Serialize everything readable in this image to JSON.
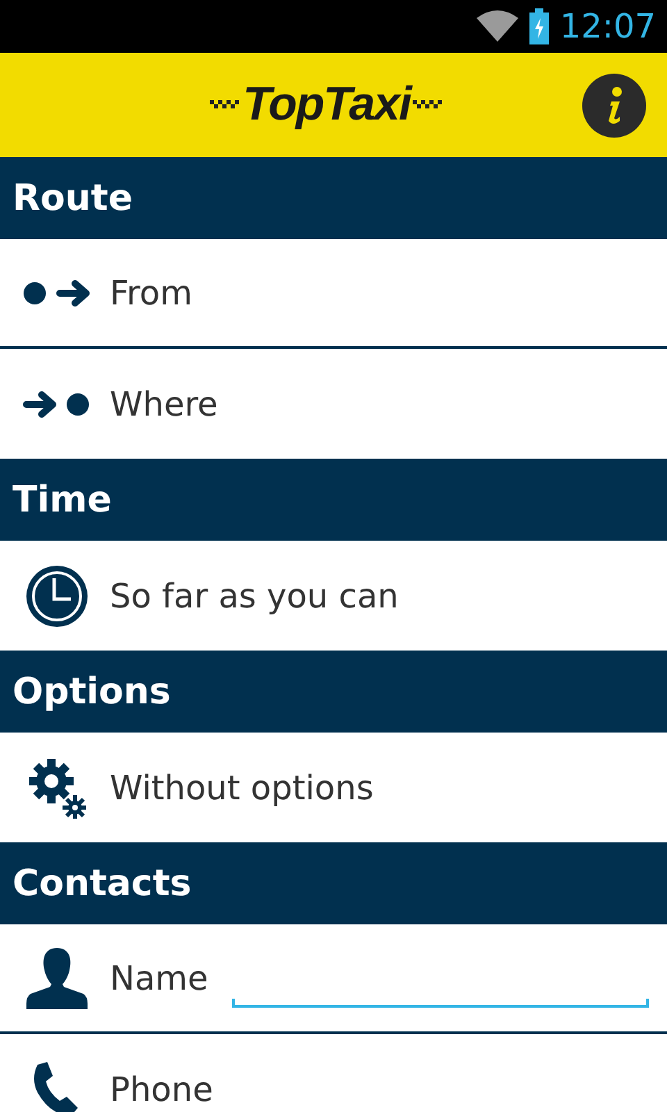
{
  "status_bar": {
    "time": "12:07"
  },
  "header": {
    "logo": "TopTaxi"
  },
  "sections": [
    {
      "title": "Route",
      "rows": [
        {
          "kind": "label",
          "label": "From"
        },
        {
          "kind": "label",
          "label": "Where"
        }
      ]
    },
    {
      "title": "Time",
      "rows": [
        {
          "kind": "label",
          "label": "So far as you can"
        }
      ]
    },
    {
      "title": "Options",
      "rows": [
        {
          "kind": "label",
          "label": "Without options"
        }
      ]
    },
    {
      "title": "Contacts",
      "rows": [
        {
          "kind": "input",
          "label": "Name"
        },
        {
          "kind": "label",
          "label": "Phone"
        }
      ]
    }
  ]
}
